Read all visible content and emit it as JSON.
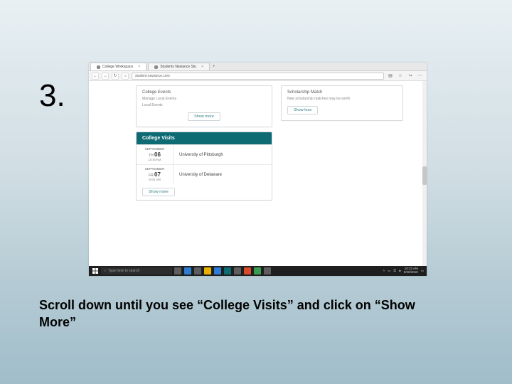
{
  "step_number": "3.",
  "caption": "Scroll down until you see “College Visits” and click on “Show More”",
  "browser": {
    "tabs": [
      {
        "label": "College Workspace"
      },
      {
        "label": "Students Naviance Stu"
      }
    ],
    "url": "student.naviance.com",
    "nav_back": "←",
    "nav_fwd": "→",
    "nav_refresh": "↻",
    "nav_home": "⌂",
    "icon_reader": "▤",
    "icon_star": "☆",
    "icon_share": "↪",
    "icon_more": "⋯"
  },
  "left_panel": {
    "title": "College Events",
    "line1": "Manage Local Events",
    "line2": "Local Events",
    "show_more": "Show more"
  },
  "college_visits": {
    "header": "College Visits",
    "items": [
      {
        "month": "SEPTEMBER",
        "dow": "TH",
        "day": "06",
        "time": "10:00AM",
        "school": "University of Pittsburgh"
      },
      {
        "month": "SEPTEMBER",
        "dow": "FR",
        "day": "07",
        "time": "9:00 AM",
        "school": "University of Delaware"
      }
    ],
    "show_more": "Show more"
  },
  "right_panel": {
    "title": "Scholarship Match",
    "sub": "New scholarship matches may be worth",
    "show_less": "Show less"
  },
  "taskbar": {
    "search_placeholder": "Type here to search",
    "time": "10:23 AM",
    "date": "9/26/2018"
  }
}
